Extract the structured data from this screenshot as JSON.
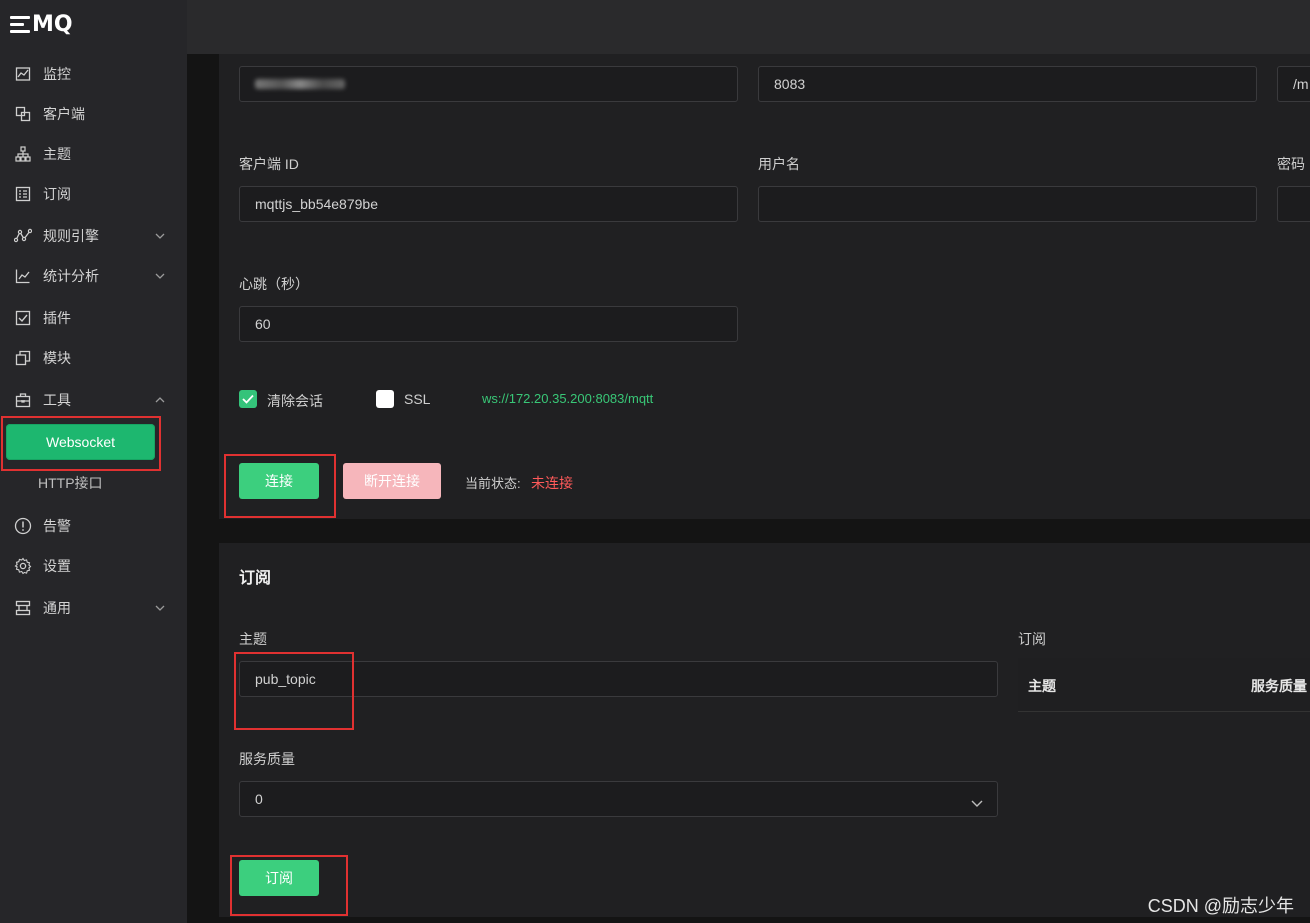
{
  "logo": {
    "text": "MQ"
  },
  "sidebar": {
    "items": [
      {
        "label": "监控",
        "icon": "monitor-chart-icon"
      },
      {
        "label": "客户端",
        "icon": "clients-icon"
      },
      {
        "label": "主题",
        "icon": "topics-tree-icon"
      },
      {
        "label": "订阅",
        "icon": "subscriptions-list-icon"
      },
      {
        "label": "规则引擎",
        "icon": "rule-engine-icon"
      },
      {
        "label": "统计分析",
        "icon": "stats-chart-icon"
      },
      {
        "label": "插件",
        "icon": "plugin-check-icon"
      },
      {
        "label": "模块",
        "icon": "modules-copy-icon"
      },
      {
        "label": "工具",
        "icon": "toolbox-icon"
      },
      {
        "label": "告警",
        "icon": "alarm-icon"
      },
      {
        "label": "设置",
        "icon": "gear-icon"
      },
      {
        "label": "通用",
        "icon": "general-icon"
      }
    ],
    "tools_sub": {
      "websocket": "Websocket",
      "http": "HTTP接口"
    }
  },
  "connection": {
    "host_value_hidden": true,
    "port_value": "8083",
    "path_value": "/m",
    "client_id_label": "客户端 ID",
    "client_id_value": "mqttjs_bb54e879be",
    "username_label": "用户名",
    "username_value": "",
    "password_label": "密码",
    "password_value": "",
    "keepalive_label": "心跳（秒）",
    "keepalive_value": "60",
    "clean_session_label": "清除会话",
    "clean_session_checked": true,
    "ssl_label": "SSL",
    "ssl_checked": false,
    "ws_url": "ws://172.20.35.200:8083/mqtt",
    "connect_button": "连接",
    "disconnect_button": "断开连接",
    "status_label": "当前状态:",
    "status_value": "未连接"
  },
  "subscribe": {
    "title": "订阅",
    "topic_label": "主题",
    "topic_value": "pub_topic",
    "qos_label": "服务质量",
    "qos_value": "0",
    "subscribe_button": "订阅",
    "list_title": "订阅",
    "table_headers": [
      "主题",
      "服务质量"
    ]
  },
  "watermark": "CSDN @励志少年",
  "colors": {
    "accent_green": "#3ccf7e",
    "active_green": "#1db76f",
    "danger_pink": "#f6b6bb",
    "status_red": "#ff5a5a",
    "url_green": "#39c777",
    "highlight_red": "#e03131"
  }
}
